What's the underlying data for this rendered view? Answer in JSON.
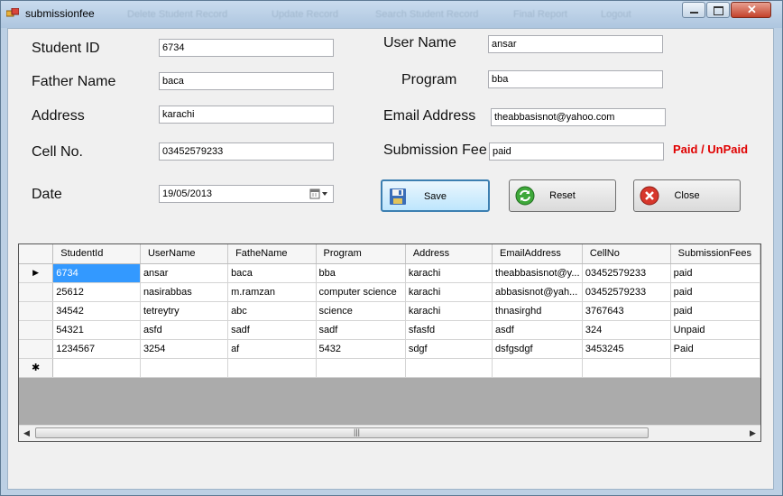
{
  "window": {
    "title": "submissionfee",
    "background_menu": [
      "Delete Student Record",
      "Update Record",
      "Search Student Record",
      "Final Report",
      "Logout"
    ]
  },
  "form": {
    "student_id": {
      "label": "Student ID",
      "value": "6734"
    },
    "father_name": {
      "label": "Father Name",
      "value": "baca"
    },
    "address": {
      "label": "Address",
      "value": "karachi"
    },
    "cell_no": {
      "label": "Cell No.",
      "value": "03452579233"
    },
    "date": {
      "label": "Date",
      "value": "19/05/2013"
    },
    "user_name": {
      "label": "User Name",
      "value": "ansar"
    },
    "program": {
      "label": "Program",
      "value": "bba"
    },
    "email": {
      "label": "Email Address",
      "value": "theabbasisnot@yahoo.com"
    },
    "submission_fee": {
      "label": "Submission Fee",
      "value": "paid"
    },
    "paid_hint": "Paid / UnPaid"
  },
  "buttons": {
    "save": "Save",
    "reset": "Reset",
    "close": "Close"
  },
  "grid": {
    "columns": [
      "StudentId",
      "UserName",
      "FatheName",
      "Program",
      "Address",
      "EmailAddress",
      "CellNo",
      "SubmissionFees"
    ],
    "rows": [
      [
        "6734",
        "ansar",
        "baca",
        "bba",
        "karachi",
        "theabbasisnot@y...",
        "03452579233",
        "paid"
      ],
      [
        "25612",
        "nasirabbas",
        "m.ramzan",
        "computer science",
        "karachi",
        "abbasisnot@yah...",
        "03452579233",
        "paid"
      ],
      [
        "34542",
        "tetreytry",
        "abc",
        "science",
        "karachi",
        "thnasirghd",
        "3767643",
        "paid"
      ],
      [
        "54321",
        "asfd",
        "sadf",
        "sadf",
        "sfasfd",
        "asdf",
        "324",
        "Unpaid"
      ],
      [
        "1234567",
        "3254",
        "af",
        "5432",
        "sdgf",
        "dsfgsdgf",
        "3453245",
        "Paid"
      ]
    ],
    "current_row_marker": "▶",
    "new_row_marker": "✱"
  },
  "colors": {
    "hint_red": "#e00000",
    "selection_blue": "#3399ff"
  },
  "icons": [
    "app-icon",
    "save-icon",
    "reset-icon",
    "close-icon",
    "calendar-icon"
  ]
}
